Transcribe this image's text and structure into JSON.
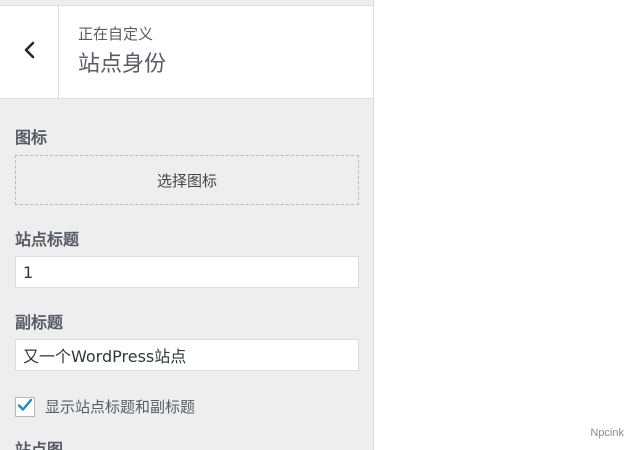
{
  "header": {
    "customizing_label": "正在自定义",
    "section_title": "站点身份",
    "back_icon": "chevron-left-icon"
  },
  "site_icon": {
    "label": "图标",
    "button_label": "选择图标"
  },
  "site_title": {
    "label": "站点标题",
    "value": "1"
  },
  "tagline": {
    "label": "副标题",
    "value": "又一个WordPress站点"
  },
  "display_header_text": {
    "label": "显示站点标题和副标题",
    "checked": true
  },
  "next_section_partial_label": "站点图",
  "watermark": "Npcink",
  "colors": {
    "accent": "#0073aa",
    "sidebar_bg": "#eeeeee",
    "text": "#555d66"
  }
}
